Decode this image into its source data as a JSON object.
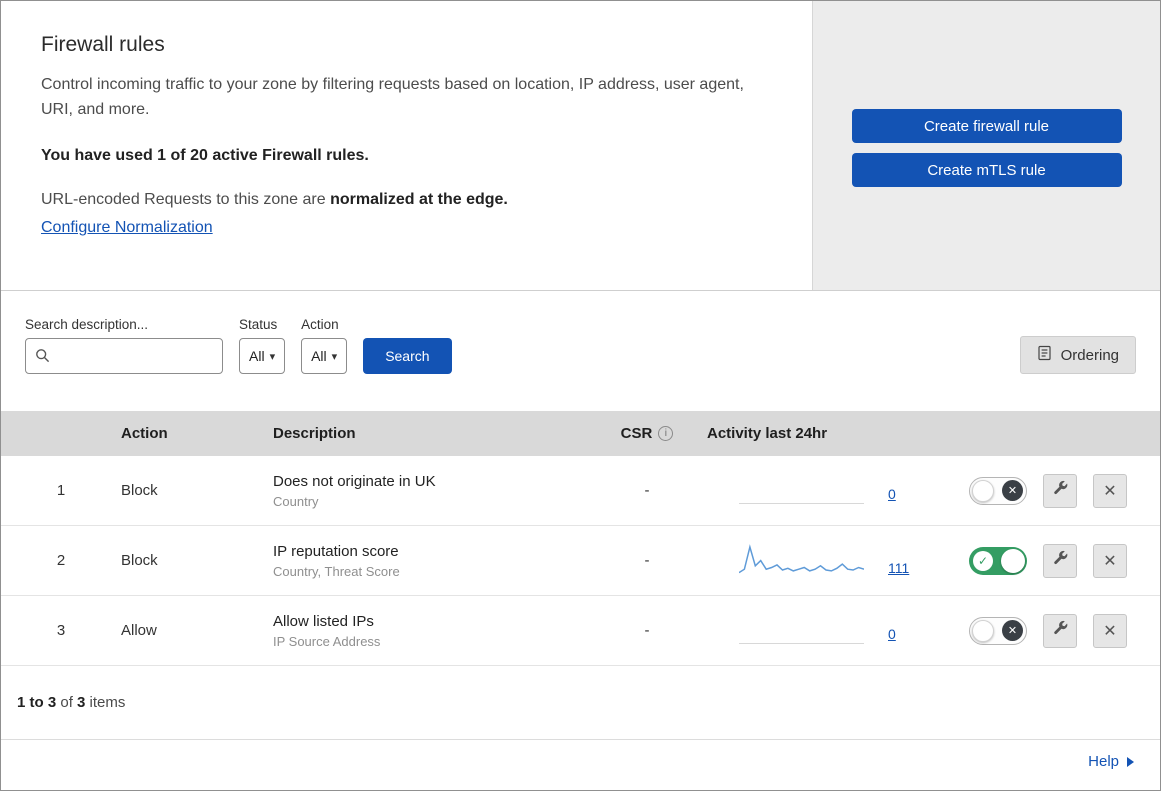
{
  "colors": {
    "accent_blue": "#1353b4",
    "toggle_green": "#349d63",
    "sparkline_blue": "#5f9bd8",
    "panel_gray": "#ececec",
    "table_header_gray": "#d9d9d9"
  },
  "header": {
    "title": "Firewall rules",
    "description": "Control incoming traffic to your zone by filtering requests based on location, IP address, user agent, URI, and more.",
    "usage": "You have used 1 of 20 active Firewall rules.",
    "normalization_text": "URL-encoded Requests to this zone are ",
    "normalization_bold": "normalized at the edge.",
    "normalization_link": "Configure Normalization"
  },
  "actions": {
    "create_firewall_rule": "Create firewall rule",
    "create_mtls_rule": "Create mTLS rule"
  },
  "filters": {
    "search_label": "Search description...",
    "status_label": "Status",
    "status_value": "All",
    "action_label": "Action",
    "action_value": "All",
    "search_button": "Search",
    "ordering_button": "Ordering"
  },
  "table": {
    "headers": {
      "action": "Action",
      "description": "Description",
      "csr": "CSR",
      "activity": "Activity last 24hr"
    },
    "rows": [
      {
        "priority": "1",
        "action": "Block",
        "description": "Does not originate in UK",
        "criteria": "Country",
        "csr": "-",
        "activity_count": "0",
        "enabled": false
      },
      {
        "priority": "2",
        "action": "Block",
        "description": "IP reputation score",
        "criteria": "Country, Threat Score",
        "csr": "-",
        "activity_count": "111",
        "enabled": true
      },
      {
        "priority": "3",
        "action": "Allow",
        "description": "Allow listed IPs",
        "criteria": "IP Source Address",
        "csr": "-",
        "activity_count": "0",
        "enabled": false
      }
    ],
    "summary": {
      "range": "1 to 3",
      "of": " of ",
      "total": "3",
      "items": " items"
    }
  },
  "footer": {
    "help": "Help"
  },
  "icons": {
    "caret": "▾",
    "close": "✕",
    "toggle_on_check": "✓",
    "toggle_off_cross": "✕",
    "info": "i"
  },
  "chart_data": [
    {
      "type": "line",
      "name": "rule-1-activity-last-24hr",
      "total": 0,
      "values": [
        0,
        0,
        0,
        0,
        0,
        0,
        0,
        0,
        0,
        0,
        0,
        0
      ]
    },
    {
      "type": "line",
      "name": "rule-2-activity-last-24hr",
      "total": 111,
      "values": [
        4,
        8,
        34,
        12,
        18,
        8,
        10,
        13,
        7,
        9,
        6,
        8,
        10,
        6,
        8,
        12,
        7,
        6,
        9,
        14,
        8,
        7,
        10,
        8
      ]
    },
    {
      "type": "line",
      "name": "rule-3-activity-last-24hr",
      "total": 0,
      "values": [
        0,
        0,
        0,
        0,
        0,
        0,
        0,
        0,
        0,
        0,
        0,
        0
      ]
    }
  ]
}
